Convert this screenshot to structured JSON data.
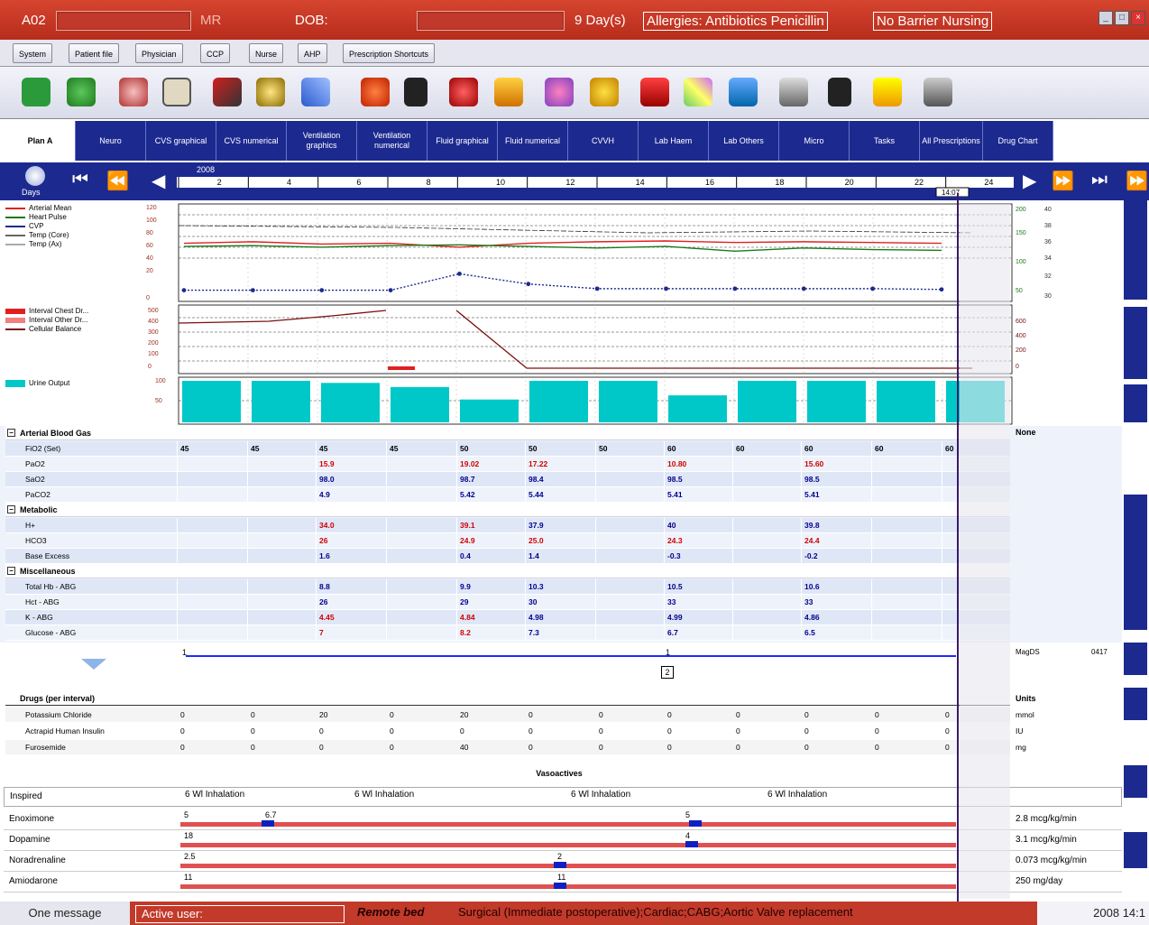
{
  "titlebar": {
    "unit": "A02",
    "mr_label": "MR",
    "dob_label": "DOB:",
    "day_label": "9 Day(s)",
    "allergies": "Allergies: Antibiotics  Penicillin",
    "barrier": "No Barrier Nursing"
  },
  "menu": [
    "System",
    "Patient file",
    "Physician",
    "CCP",
    "Nurse",
    "AHP",
    "Prescription Shortcuts"
  ],
  "toolbar_icons": [
    "chart-icon",
    "refresh-icon",
    "eye-icon",
    "notebook-icon",
    "syringe-icon",
    "clock-icon",
    "pen-icon",
    "apple-icon",
    "people-icon",
    "bag-icon",
    "box-icon",
    "gear-icon",
    "timer-icon",
    "siren-icon",
    "map-icon",
    "patient-icon",
    "printer-icon",
    "binoculars-icon",
    "note-icon",
    "folders-icon"
  ],
  "tabs": [
    "Plan A",
    "Neuro",
    "CVS graphical",
    "CVS numerical",
    "Ventilation graphics",
    "Ventilation numerical",
    "Fluid graphical",
    "Fluid numerical",
    "CVVH",
    "Lab Haem",
    "Lab Others",
    "Micro",
    "Tasks",
    "All Prescriptions",
    "Drug Chart"
  ],
  "timeline": {
    "date": "2008",
    "hours": [
      "2",
      "4",
      "6",
      "8",
      "10",
      "12",
      "14",
      "16",
      "18",
      "20",
      "22",
      "24"
    ],
    "current_time": "14:07",
    "days_label": "Days"
  },
  "legend_vitals": [
    "Arterial Mean",
    "Heart Pulse",
    "CVP",
    "Temp (Core)",
    "Temp (Ax)"
  ],
  "vitals_left_axis": [
    "120",
    "100",
    "80",
    "60",
    "40",
    "20",
    "0"
  ],
  "vitals_right_axis": [
    "200",
    "150",
    "100",
    "50"
  ],
  "temp_axis": [
    "40",
    "38",
    "36",
    "34",
    "32",
    "30"
  ],
  "legend_drains": [
    "Interval Chest Dr...",
    "Interval Other Dr...",
    "Cellular Balance"
  ],
  "drain_left_axis": [
    "500",
    "400",
    "300",
    "200",
    "100",
    "0"
  ],
  "drain_right_axis": [
    "600",
    "400",
    "200",
    "0"
  ],
  "legend_urine": "Urine Output",
  "urine_axis": [
    "100",
    "50"
  ],
  "chart_data": [
    {
      "type": "line",
      "series": [
        {
          "name": "Arterial Mean",
          "values": [
            72,
            74,
            71,
            72,
            67,
            72,
            74,
            75,
            73,
            74,
            73,
            72
          ]
        },
        {
          "name": "Heart Pulse",
          "values": [
            68,
            69,
            67,
            69,
            70,
            68,
            66,
            68,
            62,
            66,
            64,
            63
          ]
        },
        {
          "name": "CVP",
          "values": [
            12,
            12,
            12,
            12,
            33,
            20,
            14,
            14,
            14,
            14,
            14,
            13
          ]
        }
      ]
    },
    {
      "type": "bar",
      "series": [
        {
          "name": "Urine Output",
          "values": [
            100,
            100,
            95,
            85,
            55,
            100,
            100,
            65,
            100,
            100,
            100,
            100
          ]
        }
      ]
    }
  ],
  "abg": {
    "group_title": "Arterial Blood Gas",
    "right_label": "None",
    "rows": [
      {
        "label": "FiO2 (Set)",
        "values": [
          "45",
          "45",
          "45",
          "45",
          "50",
          "50",
          "50",
          "60",
          "60",
          "60",
          "60",
          "60"
        ],
        "style": "plain"
      },
      {
        "label": "PaO2",
        "values": [
          "",
          "",
          "15.9",
          "",
          "19.02",
          "17.22",
          "",
          "10.80",
          "",
          "15.60",
          "",
          ""
        ],
        "style": "red"
      },
      {
        "label": "SaO2",
        "values": [
          "",
          "",
          "98.0",
          "",
          "98.7",
          "98.4",
          "",
          "98.5",
          "",
          "98.5",
          "",
          ""
        ],
        "style": "blue"
      },
      {
        "label": "PaCO2",
        "values": [
          "",
          "",
          "4.9",
          "",
          "5.42",
          "5.44",
          "",
          "5.41",
          "",
          "5.41",
          "",
          ""
        ],
        "style": "blue"
      }
    ]
  },
  "metabolic": {
    "group_title": "Metabolic",
    "rows": [
      {
        "label": "H+",
        "values": [
          "",
          "",
          "34.0",
          "",
          "39.1",
          "37.9",
          "",
          "40",
          "",
          "39.8",
          "",
          ""
        ],
        "style": "mixed"
      },
      {
        "label": "HCO3",
        "values": [
          "",
          "",
          "26",
          "",
          "24.9",
          "25.0",
          "",
          "24.3",
          "",
          "24.4",
          "",
          ""
        ],
        "style": "red"
      },
      {
        "label": "Base Excess",
        "values": [
          "",
          "",
          "1.6",
          "",
          "0.4",
          "1.4",
          "",
          "-0.3",
          "",
          "-0.2",
          "",
          ""
        ],
        "style": "blue"
      }
    ]
  },
  "misc": {
    "group_title": "Miscellaneous",
    "rows": [
      {
        "label": "Total Hb - ABG",
        "values": [
          "",
          "",
          "8.8",
          "",
          "9.9",
          "10.3",
          "",
          "10.5",
          "",
          "10.6",
          "",
          ""
        ],
        "style": "blue"
      },
      {
        "label": "Hct - ABG",
        "values": [
          "",
          "",
          "26",
          "",
          "29",
          "30",
          "",
          "33",
          "",
          "33",
          "",
          ""
        ],
        "style": "blue"
      },
      {
        "label": "K - ABG",
        "values": [
          "",
          "",
          "4.45",
          "",
          "4.84",
          "4.98",
          "",
          "4.99",
          "",
          "4.86",
          "",
          ""
        ],
        "style": "mixed"
      },
      {
        "label": "Glucose - ABG",
        "values": [
          "",
          "",
          "7",
          "",
          "8.2",
          "7.3",
          "",
          "6.7",
          "",
          "6.5",
          "",
          ""
        ],
        "style": "mixed"
      }
    ]
  },
  "timeline_marker": {
    "left": "1",
    "mid": "1",
    "box": "2",
    "right1": "MagDS",
    "right2": "0417"
  },
  "drugs": {
    "group_title": "Drugs (per interval)",
    "right_label": "Units",
    "rows": [
      {
        "label": "Potassium Chloride",
        "values": [
          "0",
          "0",
          "20",
          "0",
          "20",
          "0",
          "0",
          "0",
          "0",
          "0",
          "0",
          "0"
        ],
        "unit": "mmol"
      },
      {
        "label": "Actrapid Human Insulin",
        "values": [
          "0",
          "0",
          "0",
          "0",
          "0",
          "0",
          "0",
          "0",
          "0",
          "0",
          "0",
          "0"
        ],
        "unit": "IU"
      },
      {
        "label": "Furosemide",
        "values": [
          "0",
          "0",
          "0",
          "0",
          "40",
          "0",
          "0",
          "0",
          "0",
          "0",
          "0",
          "0"
        ],
        "unit": "mg"
      }
    ]
  },
  "vasoactives": {
    "title": "Vasoactives",
    "inspired_label": "Inspired",
    "inspired_values": [
      "6 Wl Inhalation",
      "6 Wl Inhalation",
      "6 Wl Inhalation",
      "6 Wl Inhalation"
    ],
    "rows": [
      {
        "label": "Enoximone",
        "markers": [
          "5",
          "6.7",
          "5"
        ],
        "rate": "2.8 mcg/kg/min"
      },
      {
        "label": "Dopamine",
        "markers": [
          "18",
          "4"
        ],
        "rate": "3.1 mcg/kg/min"
      },
      {
        "label": "Noradrenaline",
        "markers": [
          "2.5",
          "2"
        ],
        "rate": "0.073 mcg/kg/min"
      },
      {
        "label": "Amiodarone",
        "markers": [
          "11",
          "11"
        ],
        "rate": "250 mg/day"
      }
    ]
  },
  "status": {
    "messages": "One message",
    "active_user": "Active user:",
    "remote_bed": "Remote bed",
    "diagnosis": "Surgical (Immediate postoperative);Cardiac;CABG;Aortic Valve replacement",
    "datetime": "2008 14:1"
  }
}
